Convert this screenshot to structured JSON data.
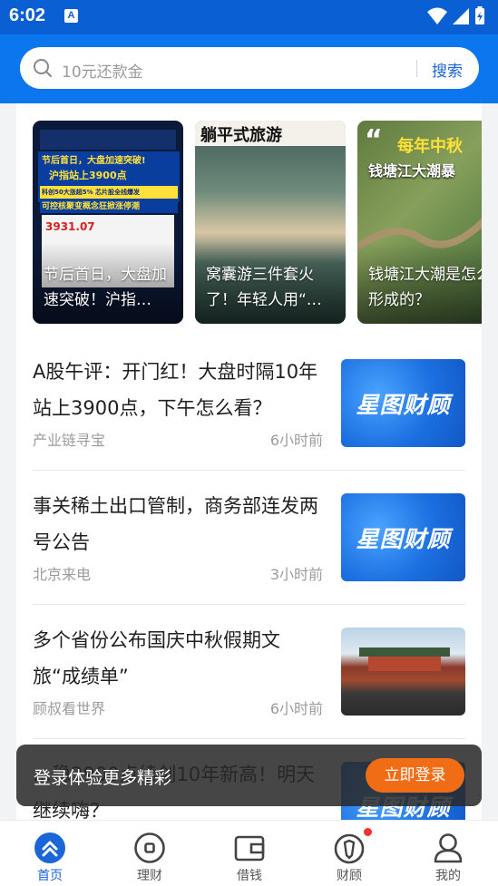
{
  "status_bar": {
    "time": "6:02",
    "notification_glyph": "A"
  },
  "search": {
    "placeholder": "10元还款金",
    "button_label": "搜索"
  },
  "stories": [
    {
      "caption": "节后首日，大盘加速突破！沪指…",
      "overlay_lines": [
        "节后首日，大盘加速突破!",
        "沪指站上3900点",
        "科创50大涨超5% 芯片股全线爆发",
        "可控核聚变概念狂掀涨停潮"
      ],
      "overlay_number": "3931.07"
    },
    {
      "caption": "窝囊游三件套火了！年轻人用“…",
      "overlay_title": "躺平式旅游"
    },
    {
      "caption": "钱塘江大潮是怎么形成的？",
      "overlay_title_1": "每年中秋",
      "overlay_title_2": "钱塘江大潮暴"
    }
  ],
  "news": [
    {
      "title": "A股午评：开门红！大盘时隔10年站上3900点，下午怎么看？",
      "source": "产业链寻宝",
      "time": "6小时前",
      "thumb": "brand",
      "thumb_text": "星图财顾"
    },
    {
      "title": "事关稀土出口管制，商务部连发两号公告",
      "source": "北京来电",
      "time": "3小时前",
      "thumb": "brand",
      "thumb_text": "星图财顾"
    },
    {
      "title": "多个省份公布国庆中秋假期文旅“成绩单”",
      "source": "顾叔看世界",
      "time": "6小时前",
      "thumb": "photo",
      "thumb_text": ""
    },
    {
      "title": "…稳3900点续创10年新高！明天继续嗨？",
      "source": "",
      "time": "",
      "thumb": "brand",
      "thumb_text": "星图财顾"
    }
  ],
  "toast": {
    "text": "登录体验更多精彩",
    "button_label": "立即登录"
  },
  "bottom_nav": [
    {
      "label": "首页",
      "icon": "home-chevron-icon",
      "active": true
    },
    {
      "label": "理财",
      "icon": "wealth-circle-icon",
      "active": false
    },
    {
      "label": "借钱",
      "icon": "wallet-icon",
      "active": false
    },
    {
      "label": "财顾",
      "icon": "advisor-icon",
      "active": false,
      "badge": true
    },
    {
      "label": "我的",
      "icon": "user-icon",
      "active": false
    }
  ],
  "colors": {
    "primary": "#0c76ee",
    "accent": "#f06d15",
    "badge": "#f23030"
  }
}
